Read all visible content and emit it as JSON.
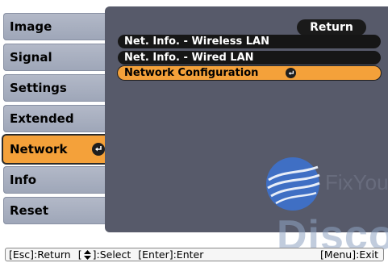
{
  "sidebar": {
    "items": [
      {
        "label": "Image"
      },
      {
        "label": "Signal"
      },
      {
        "label": "Settings"
      },
      {
        "label": "Extended"
      },
      {
        "label": "Network",
        "active": true
      },
      {
        "label": "Info"
      },
      {
        "label": "Reset"
      }
    ]
  },
  "panel": {
    "return_label": "Return",
    "items": [
      {
        "label": "Net. Info. - Wireless LAN"
      },
      {
        "label": "Net. Info. - Wired LAN"
      },
      {
        "label": "Network Configuration",
        "selected": true
      }
    ]
  },
  "watermark": {
    "text": "FixYou",
    "large_text": "Disco"
  },
  "help_bar": {
    "esc": "[Esc]:Return",
    "select_pre": "[",
    "select_post": "]:Select",
    "enter": "[Enter]:Enter",
    "menu": "[Menu]:Exit"
  },
  "colors": {
    "accent": "#f4a13a",
    "panel_bg": "#575a6a",
    "sidebar_bg": "#a8afc0"
  }
}
